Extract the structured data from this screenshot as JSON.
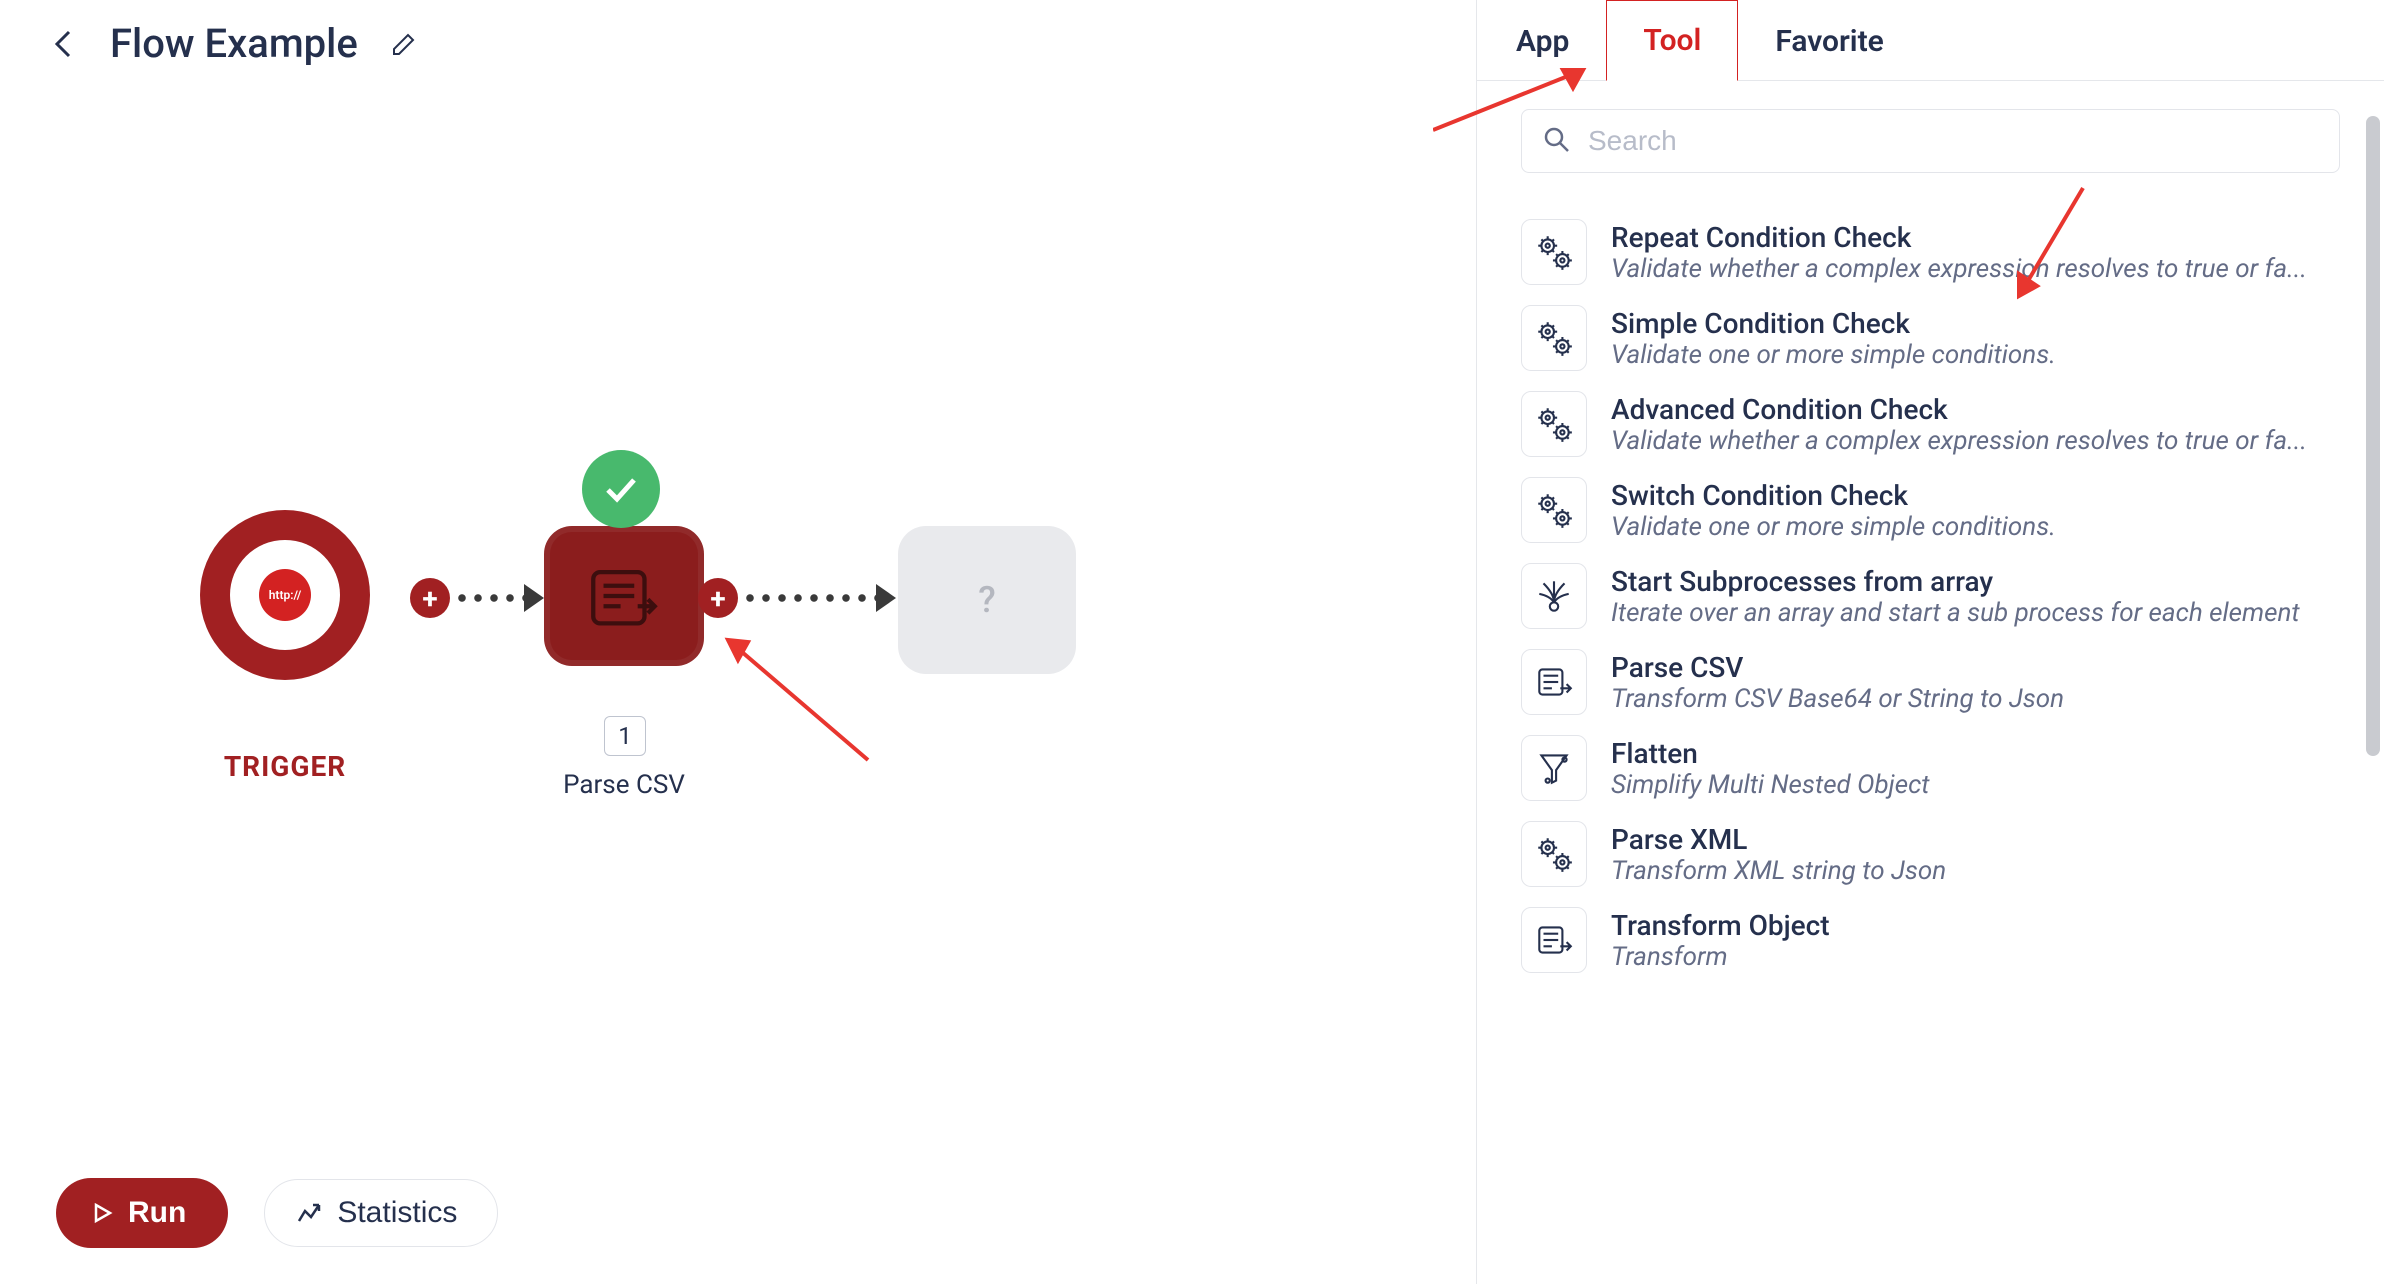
{
  "header": {
    "title": "Flow Example"
  },
  "canvas": {
    "trigger_label": "TRIGGER",
    "trigger_chip_text": "http://",
    "action_node_label": "Parse CSV",
    "action_node_count": "1",
    "placeholder_node_label": "?"
  },
  "footer": {
    "run_label": "Run",
    "stats_label": "Statistics"
  },
  "side_panel": {
    "tabs": {
      "app": "App",
      "tool": "Tool",
      "favorite": "Favorite"
    },
    "active_tab": "tool",
    "search_placeholder": "Search",
    "tools": [
      {
        "title": "Repeat Condition Check",
        "desc": "Validate whether a complex expression resolves to true or fa...",
        "icon": "gears"
      },
      {
        "title": "Simple Condition Check",
        "desc": "Validate one or more simple conditions.",
        "icon": "gears"
      },
      {
        "title": "Advanced Condition Check",
        "desc": "Validate whether a complex expression resolves to true or fa...",
        "icon": "gears"
      },
      {
        "title": "Switch Condition Check",
        "desc": "Validate one or more simple conditions.",
        "icon": "gears"
      },
      {
        "title": "Start Subprocesses from array",
        "desc": "Iterate over an array and start a sub process for each element",
        "icon": "burst"
      },
      {
        "title": "Parse CSV",
        "desc": "Transform CSV Base64 or String to Json",
        "icon": "flow"
      },
      {
        "title": "Flatten",
        "desc": "Simplify Multi Nested Object",
        "icon": "funnel"
      },
      {
        "title": "Parse XML",
        "desc": "Transform XML string to Json",
        "icon": "gears"
      },
      {
        "title": "Transform Object",
        "desc": "Transform",
        "icon": "flow"
      }
    ]
  }
}
